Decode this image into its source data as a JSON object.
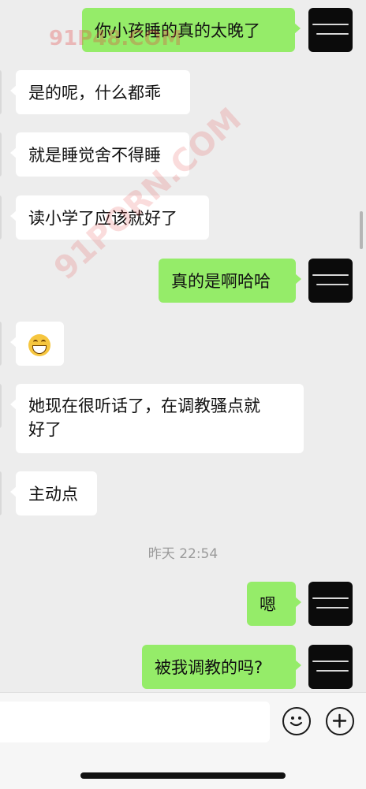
{
  "messages": [
    {
      "side": "out",
      "text": "你小孩睡的真的太晚了"
    },
    {
      "side": "in",
      "text": "是的呢，什么都乖"
    },
    {
      "side": "in",
      "text": "就是睡觉舍不得睡"
    },
    {
      "side": "in",
      "text": "读小学了应该就好了"
    },
    {
      "side": "out",
      "text": "真的是啊哈哈"
    },
    {
      "side": "in",
      "emoji": "grinning-face-emoji"
    },
    {
      "side": "in",
      "line1": "她现在很听话了，在调教骚点就",
      "line2": "好了"
    },
    {
      "side": "in",
      "text": "主动点"
    },
    {
      "side": "out",
      "text": "嗯"
    },
    {
      "side": "out",
      "text": "被我调教的吗?"
    }
  ],
  "timestamp": "昨天 22:54",
  "watermark": {
    "top": "91P48.COM",
    "diagonal": "91PORN.COM"
  },
  "input": {
    "value": "",
    "placeholder": ""
  },
  "icons": {
    "emoji_button": "smiley-face-icon",
    "add_button": "plus-circle-icon"
  },
  "colors": {
    "outgoing": "#95ec69",
    "incoming": "#ffffff",
    "background": "#ededed"
  }
}
